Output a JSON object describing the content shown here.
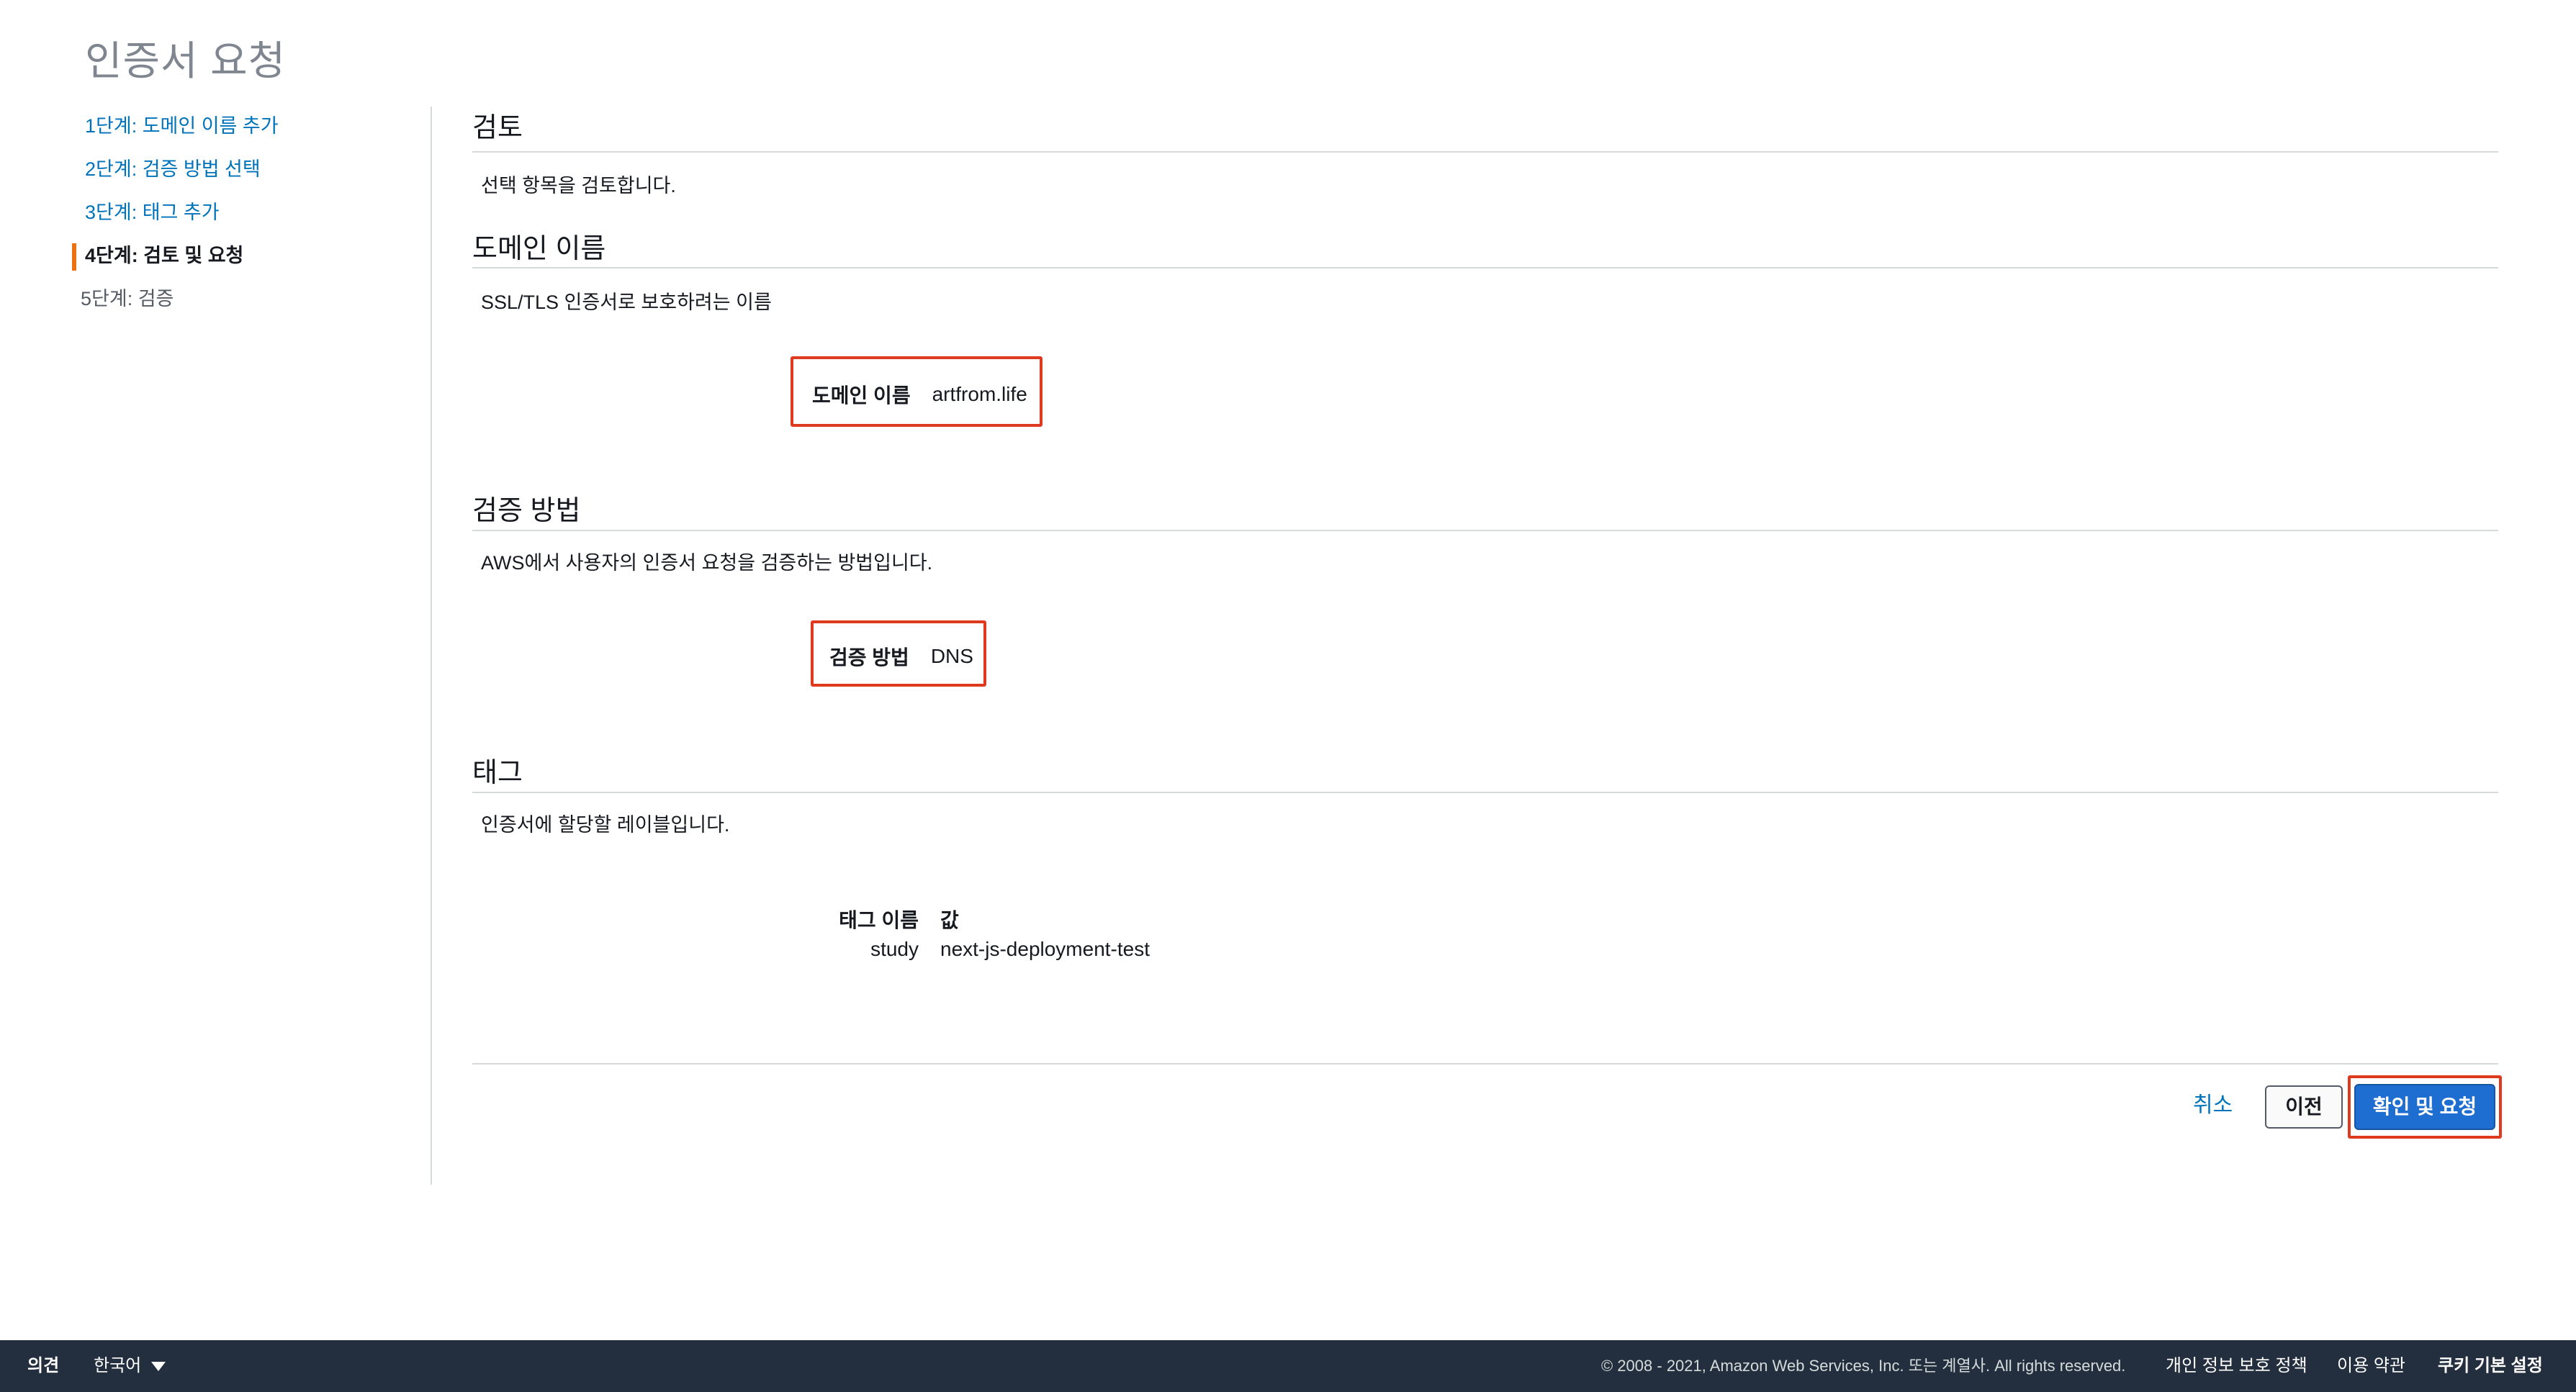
{
  "page": {
    "title": "인증서 요청"
  },
  "steps": [
    {
      "label": "1단계: 도메인 이름 추가"
    },
    {
      "label": "2단계: 검증 방법 선택"
    },
    {
      "label": "3단계: 태그 추가"
    },
    {
      "label": "4단계: 검토 및 요청"
    },
    {
      "label": "5단계: 검증"
    }
  ],
  "review": {
    "title": "검토",
    "description": "선택 항목을 검토합니다."
  },
  "domain": {
    "title": "도메인 이름",
    "description": "SSL/TLS 인증서로 보호하려는 이름",
    "key": "도메인 이름",
    "value": "artfrom.life"
  },
  "validation": {
    "title": "검증 방법",
    "description": "AWS에서 사용자의 인증서 요청을 검증하는 방법입니다.",
    "key": "검증 방법",
    "value": "DNS"
  },
  "tags": {
    "title": "태그",
    "description": "인증서에 할당할 레이블입니다.",
    "header_name": "태그 이름",
    "header_value": "값",
    "rows": [
      {
        "name": "study",
        "value": "next-js-deployment-test"
      }
    ]
  },
  "actions": {
    "cancel": "취소",
    "previous": "이전",
    "confirm": "확인 및 요청"
  },
  "footer": {
    "feedback": "의견",
    "language": "한국어",
    "copyright": "© 2008 - 2021, Amazon Web Services, Inc. 또는 계열사. All rights reserved.",
    "privacy": "개인 정보 보호 정책",
    "terms": "이용 약관",
    "cookies": "쿠키 기본 설정"
  }
}
